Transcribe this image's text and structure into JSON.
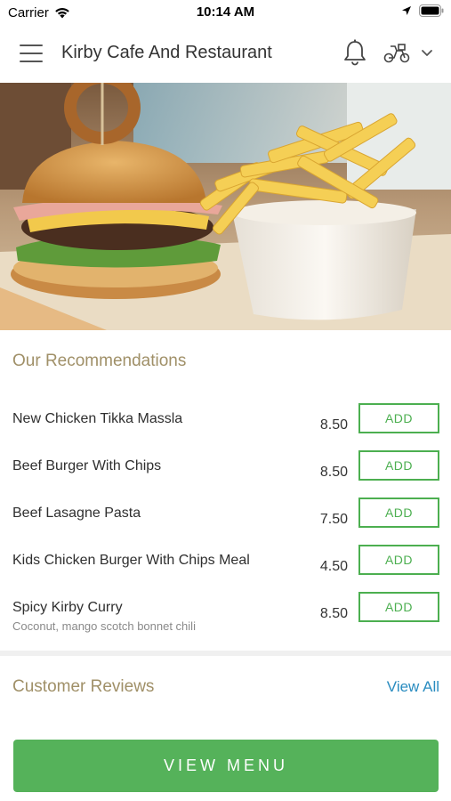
{
  "status_bar": {
    "carrier": "Carrier",
    "time": "10:14 AM"
  },
  "header": {
    "restaurant_name": "Kirby Cafe And Restaurant",
    "icons": [
      "menu-icon",
      "bell-icon",
      "scooter-icon",
      "chevron-down-icon"
    ]
  },
  "recommendations": {
    "title": "Our Recommendations",
    "add_label": "ADD",
    "items": [
      {
        "name": "New Chicken Tikka Massla",
        "price": "8.50",
        "description": ""
      },
      {
        "name": "Beef Burger With Chips",
        "price": "8.50",
        "description": ""
      },
      {
        "name": "Beef Lasagne Pasta",
        "price": "7.50",
        "description": ""
      },
      {
        "name": "Kids Chicken Burger With Chips Meal",
        "price": "4.50",
        "description": ""
      },
      {
        "name": "Spicy Kirby Curry",
        "price": "8.50",
        "description": "Coconut, mango scotch bonnet chili"
      }
    ]
  },
  "reviews": {
    "title": "Customer Reviews",
    "view_all": "View All"
  },
  "footer": {
    "view_menu": "VIEW MENU"
  },
  "colors": {
    "accent_green": "#55b25a",
    "section_title": "#a09068",
    "link_blue": "#2a8cc0"
  }
}
